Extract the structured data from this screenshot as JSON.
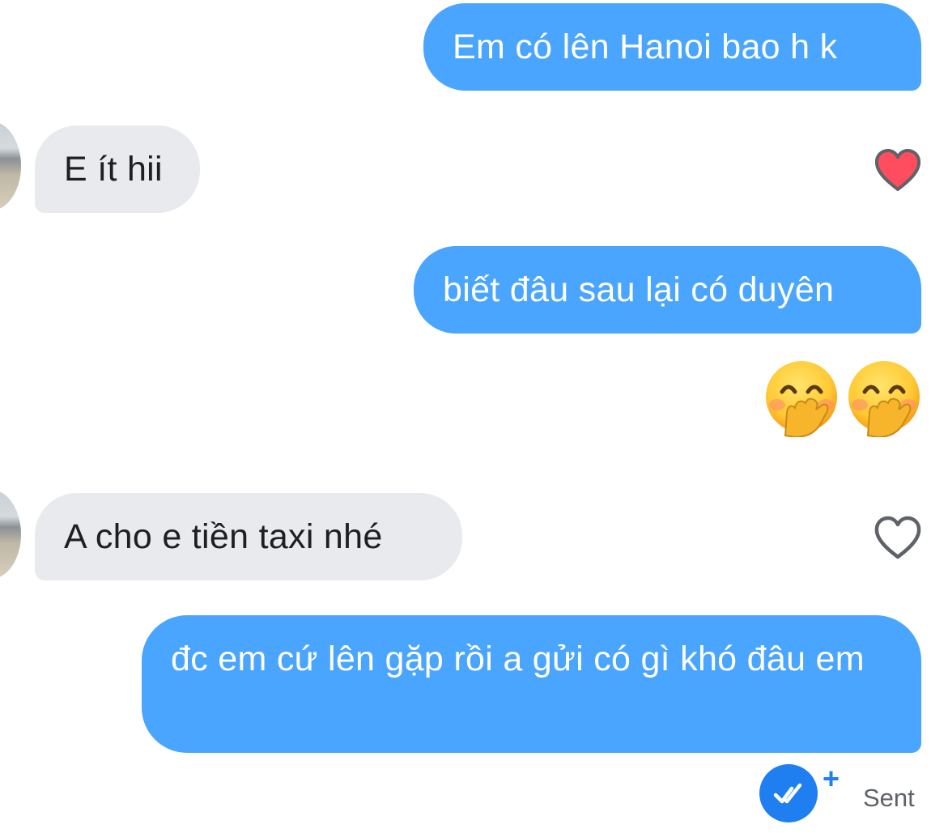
{
  "messages": [
    {
      "direction": "outgoing",
      "text": "Em có lên Hanoi bao h k"
    },
    {
      "direction": "incoming",
      "text": "E ít hii",
      "reaction": "heart-filled"
    },
    {
      "direction": "outgoing",
      "text": "biết đâu sau lại có duyên"
    },
    {
      "direction": "outgoing",
      "type": "emoji",
      "emojis": [
        "face-with-hand-over-mouth",
        "face-with-hand-over-mouth"
      ]
    },
    {
      "direction": "incoming",
      "text": "A cho e tiền taxi nhé",
      "reaction": "heart-outline"
    },
    {
      "direction": "outgoing",
      "text": "đc em cứ lên gặp rồi a gửi có gì khó đâu em"
    }
  ],
  "status": {
    "plus": "+",
    "label": "Sent",
    "icon": "double-check-icon"
  },
  "colors": {
    "outgoing_bubble": "#4aa5fe",
    "incoming_bubble": "#e9eaee",
    "heart_filled": "#fd4d5e",
    "heart_outline": "#5f6368",
    "status_blue": "#1f7ff0"
  }
}
